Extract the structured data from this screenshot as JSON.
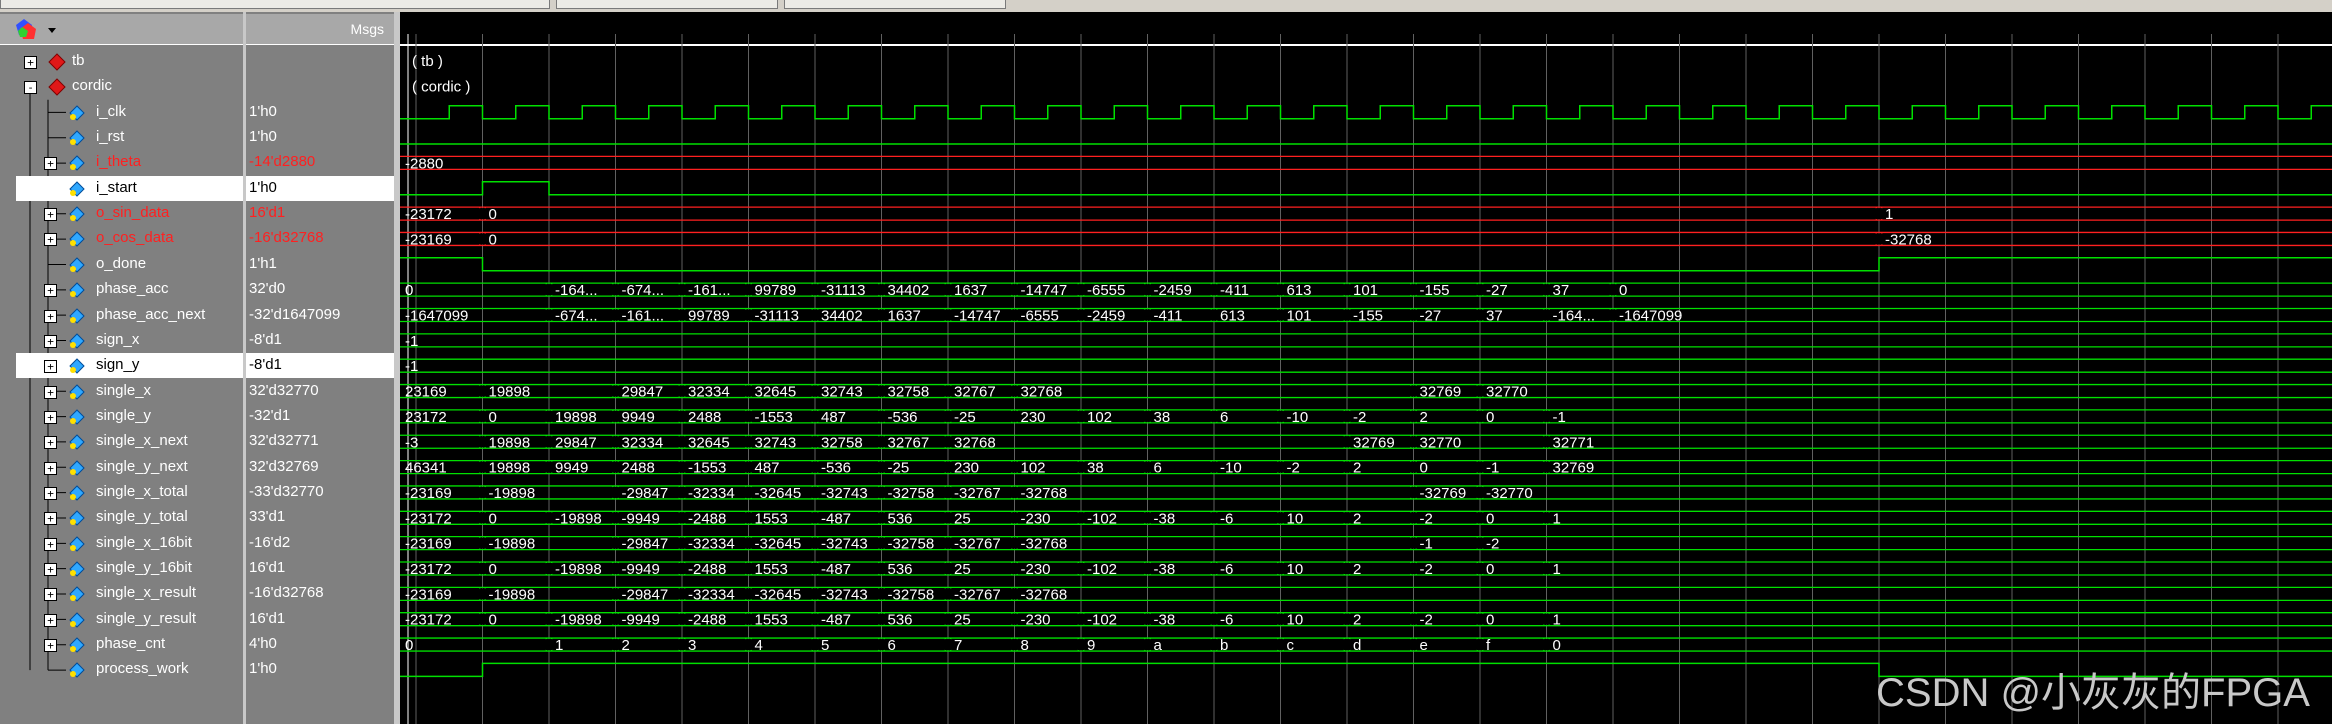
{
  "header": {
    "msgs_label": "Msgs"
  },
  "watermark": "CSDN @小灰灰的FPGA",
  "colors": {
    "wave": "#00e000",
    "red": "#ff2020",
    "cursor": "#ffffff",
    "grid": "#606060",
    "label": "#ffffff"
  },
  "signals": [
    {
      "name": "tb",
      "value": "",
      "kind": "instance",
      "expand": "+",
      "color": "white",
      "labels": [
        {
          "x": 0,
          "text": "( tb )"
        }
      ]
    },
    {
      "name": "cordic",
      "value": "",
      "kind": "instance",
      "expand": "-",
      "color": "white",
      "labels": [
        {
          "x": 0,
          "text": "( cordic )"
        }
      ]
    },
    {
      "name": "i_clk",
      "value": "1'h0",
      "kind": "clock",
      "color": "white"
    },
    {
      "name": "i_rst",
      "value": "1'h0",
      "kind": "low",
      "color": "white"
    },
    {
      "name": "i_theta",
      "value": "-14'd2880",
      "kind": "bus",
      "expand": "+",
      "color": "red",
      "labels": [
        {
          "x": 0,
          "text": "-2880"
        }
      ]
    },
    {
      "name": "i_start",
      "value": "1'h0",
      "kind": "pulse",
      "start": 1,
      "end": 2,
      "color": "white",
      "selected": true
    },
    {
      "name": "o_sin_data",
      "value": "16'd1",
      "kind": "bus",
      "expand": "+",
      "color": "red",
      "labels": [
        {
          "x": 0,
          "text": "-23172"
        },
        {
          "x": 1,
          "text": "0"
        },
        {
          "x": 22,
          "text": "1"
        }
      ]
    },
    {
      "name": "o_cos_data",
      "value": "-16'd32768",
      "kind": "bus",
      "expand": "+",
      "color": "red",
      "labels": [
        {
          "x": 0,
          "text": "-23169"
        },
        {
          "x": 1,
          "text": "0"
        },
        {
          "x": 22,
          "text": "-32768"
        }
      ]
    },
    {
      "name": "o_done",
      "value": "1'h1",
      "kind": "step_down_up",
      "down": 1,
      "up": 22,
      "color": "white"
    },
    {
      "name": "phase_acc",
      "value": "32'd0",
      "kind": "bus",
      "expand": "+",
      "color": "white",
      "labels": [
        {
          "x": 0,
          "text": "0"
        },
        {
          "x": 2,
          "text": "-164..."
        },
        {
          "x": 3,
          "text": "-674..."
        },
        {
          "x": 4,
          "text": "-161..."
        },
        {
          "x": 5,
          "text": "99789"
        },
        {
          "x": 6,
          "text": "-31113"
        },
        {
          "x": 7,
          "text": "34402"
        },
        {
          "x": 8,
          "text": "1637"
        },
        {
          "x": 9,
          "text": "-14747"
        },
        {
          "x": 10,
          "text": "-6555"
        },
        {
          "x": 11,
          "text": "-2459"
        },
        {
          "x": 12,
          "text": "-411"
        },
        {
          "x": 13,
          "text": "613"
        },
        {
          "x": 14,
          "text": "101"
        },
        {
          "x": 15,
          "text": "-155"
        },
        {
          "x": 16,
          "text": "-27"
        },
        {
          "x": 17,
          "text": "37"
        },
        {
          "x": 18,
          "text": "0"
        }
      ]
    },
    {
      "name": "phase_acc_next",
      "value": "-32'd1647099",
      "kind": "bus",
      "expand": "+",
      "color": "white",
      "labels": [
        {
          "x": 0,
          "text": "-1647099"
        },
        {
          "x": 2,
          "text": "-674..."
        },
        {
          "x": 3,
          "text": "-161..."
        },
        {
          "x": 4,
          "text": "99789"
        },
        {
          "x": 5,
          "text": "-31113"
        },
        {
          "x": 6,
          "text": "34402"
        },
        {
          "x": 7,
          "text": "1637"
        },
        {
          "x": 8,
          "text": "-14747"
        },
        {
          "x": 9,
          "text": "-6555"
        },
        {
          "x": 10,
          "text": "-2459"
        },
        {
          "x": 11,
          "text": "-411"
        },
        {
          "x": 12,
          "text": "613"
        },
        {
          "x": 13,
          "text": "101"
        },
        {
          "x": 14,
          "text": "-155"
        },
        {
          "x": 15,
          "text": "-27"
        },
        {
          "x": 16,
          "text": "37"
        },
        {
          "x": 17,
          "text": "-164..."
        },
        {
          "x": 18,
          "text": "-1647099"
        }
      ]
    },
    {
      "name": "sign_x",
      "value": "-8'd1",
      "kind": "bus",
      "expand": "+",
      "color": "white",
      "labels": [
        {
          "x": 0,
          "text": "-1"
        }
      ]
    },
    {
      "name": "sign_y",
      "value": "-8'd1",
      "kind": "bus",
      "expand": "+",
      "color": "white",
      "selected": true,
      "labels": [
        {
          "x": 0,
          "text": "-1"
        }
      ]
    },
    {
      "name": "single_x",
      "value": "32'd32770",
      "kind": "bus",
      "expand": "+",
      "color": "white",
      "labels": [
        {
          "x": 0,
          "text": "23169"
        },
        {
          "x": 1,
          "text": "19898"
        },
        {
          "x": 3,
          "text": "29847"
        },
        {
          "x": 4,
          "text": "32334"
        },
        {
          "x": 5,
          "text": "32645"
        },
        {
          "x": 6,
          "text": "32743"
        },
        {
          "x": 7,
          "text": "32758"
        },
        {
          "x": 8,
          "text": "32767"
        },
        {
          "x": 9,
          "text": "32768"
        },
        {
          "x": 15,
          "text": "32769"
        },
        {
          "x": 16,
          "text": "32770"
        }
      ]
    },
    {
      "name": "single_y",
      "value": "-32'd1",
      "kind": "bus",
      "expand": "+",
      "color": "white",
      "labels": [
        {
          "x": 0,
          "text": "23172"
        },
        {
          "x": 1,
          "text": "0"
        },
        {
          "x": 2,
          "text": "19898"
        },
        {
          "x": 3,
          "text": "9949"
        },
        {
          "x": 4,
          "text": "2488"
        },
        {
          "x": 5,
          "text": "-1553"
        },
        {
          "x": 6,
          "text": "487"
        },
        {
          "x": 7,
          "text": "-536"
        },
        {
          "x": 8,
          "text": "-25"
        },
        {
          "x": 9,
          "text": "230"
        },
        {
          "x": 10,
          "text": "102"
        },
        {
          "x": 11,
          "text": "38"
        },
        {
          "x": 12,
          "text": "6"
        },
        {
          "x": 13,
          "text": "-10"
        },
        {
          "x": 14,
          "text": "-2"
        },
        {
          "x": 15,
          "text": "2"
        },
        {
          "x": 16,
          "text": "0"
        },
        {
          "x": 17,
          "text": "-1"
        }
      ]
    },
    {
      "name": "single_x_next",
      "value": "32'd32771",
      "kind": "bus",
      "expand": "+",
      "color": "white",
      "labels": [
        {
          "x": 0,
          "text": "-3"
        },
        {
          "x": 1,
          "text": "19898"
        },
        {
          "x": 2,
          "text": "29847"
        },
        {
          "x": 3,
          "text": "32334"
        },
        {
          "x": 4,
          "text": "32645"
        },
        {
          "x": 5,
          "text": "32743"
        },
        {
          "x": 6,
          "text": "32758"
        },
        {
          "x": 7,
          "text": "32767"
        },
        {
          "x": 8,
          "text": "32768"
        },
        {
          "x": 14,
          "text": "32769"
        },
        {
          "x": 15,
          "text": "32770"
        },
        {
          "x": 17,
          "text": "32771"
        }
      ]
    },
    {
      "name": "single_y_next",
      "value": "32'd32769",
      "kind": "bus",
      "expand": "+",
      "color": "white",
      "labels": [
        {
          "x": 0,
          "text": "46341"
        },
        {
          "x": 1,
          "text": "19898"
        },
        {
          "x": 2,
          "text": "9949"
        },
        {
          "x": 3,
          "text": "2488"
        },
        {
          "x": 4,
          "text": "-1553"
        },
        {
          "x": 5,
          "text": "487"
        },
        {
          "x": 6,
          "text": "-536"
        },
        {
          "x": 7,
          "text": "-25"
        },
        {
          "x": 8,
          "text": "230"
        },
        {
          "x": 9,
          "text": "102"
        },
        {
          "x": 10,
          "text": "38"
        },
        {
          "x": 11,
          "text": "6"
        },
        {
          "x": 12,
          "text": "-10"
        },
        {
          "x": 13,
          "text": "-2"
        },
        {
          "x": 14,
          "text": "2"
        },
        {
          "x": 15,
          "text": "0"
        },
        {
          "x": 16,
          "text": "-1"
        },
        {
          "x": 17,
          "text": "32769"
        }
      ]
    },
    {
      "name": "single_x_total",
      "value": "-33'd32770",
      "kind": "bus",
      "expand": "+",
      "color": "white",
      "labels": [
        {
          "x": 0,
          "text": "-23169"
        },
        {
          "x": 1,
          "text": "-19898"
        },
        {
          "x": 3,
          "text": "-29847"
        },
        {
          "x": 4,
          "text": "-32334"
        },
        {
          "x": 5,
          "text": "-32645"
        },
        {
          "x": 6,
          "text": "-32743"
        },
        {
          "x": 7,
          "text": "-32758"
        },
        {
          "x": 8,
          "text": "-32767"
        },
        {
          "x": 9,
          "text": "-32768"
        },
        {
          "x": 15,
          "text": "-32769"
        },
        {
          "x": 16,
          "text": "-32770"
        }
      ]
    },
    {
      "name": "single_y_total",
      "value": "33'd1",
      "kind": "bus",
      "expand": "+",
      "color": "white",
      "labels": [
        {
          "x": 0,
          "text": "-23172"
        },
        {
          "x": 1,
          "text": "0"
        },
        {
          "x": 2,
          "text": "-19898"
        },
        {
          "x": 3,
          "text": "-9949"
        },
        {
          "x": 4,
          "text": "-2488"
        },
        {
          "x": 5,
          "text": "1553"
        },
        {
          "x": 6,
          "text": "-487"
        },
        {
          "x": 7,
          "text": "536"
        },
        {
          "x": 8,
          "text": "25"
        },
        {
          "x": 9,
          "text": "-230"
        },
        {
          "x": 10,
          "text": "-102"
        },
        {
          "x": 11,
          "text": "-38"
        },
        {
          "x": 12,
          "text": "-6"
        },
        {
          "x": 13,
          "text": "10"
        },
        {
          "x": 14,
          "text": "2"
        },
        {
          "x": 15,
          "text": "-2"
        },
        {
          "x": 16,
          "text": "0"
        },
        {
          "x": 17,
          "text": "1"
        }
      ]
    },
    {
      "name": "single_x_16bit",
      "value": "-16'd2",
      "kind": "bus",
      "expand": "+",
      "color": "white",
      "labels": [
        {
          "x": 0,
          "text": "-23169"
        },
        {
          "x": 1,
          "text": "-19898"
        },
        {
          "x": 3,
          "text": "-29847"
        },
        {
          "x": 4,
          "text": "-32334"
        },
        {
          "x": 5,
          "text": "-32645"
        },
        {
          "x": 6,
          "text": "-32743"
        },
        {
          "x": 7,
          "text": "-32758"
        },
        {
          "x": 8,
          "text": "-32767"
        },
        {
          "x": 9,
          "text": "-32768"
        },
        {
          "x": 15,
          "text": "-1"
        },
        {
          "x": 16,
          "text": "-2"
        }
      ]
    },
    {
      "name": "single_y_16bit",
      "value": "16'd1",
      "kind": "bus",
      "expand": "+",
      "color": "white",
      "labels": [
        {
          "x": 0,
          "text": "-23172"
        },
        {
          "x": 1,
          "text": "0"
        },
        {
          "x": 2,
          "text": "-19898"
        },
        {
          "x": 3,
          "text": "-9949"
        },
        {
          "x": 4,
          "text": "-2488"
        },
        {
          "x": 5,
          "text": "1553"
        },
        {
          "x": 6,
          "text": "-487"
        },
        {
          "x": 7,
          "text": "536"
        },
        {
          "x": 8,
          "text": "25"
        },
        {
          "x": 9,
          "text": "-230"
        },
        {
          "x": 10,
          "text": "-102"
        },
        {
          "x": 11,
          "text": "-38"
        },
        {
          "x": 12,
          "text": "-6"
        },
        {
          "x": 13,
          "text": "10"
        },
        {
          "x": 14,
          "text": "2"
        },
        {
          "x": 15,
          "text": "-2"
        },
        {
          "x": 16,
          "text": "0"
        },
        {
          "x": 17,
          "text": "1"
        }
      ]
    },
    {
      "name": "single_x_result",
      "value": "-16'd32768",
      "kind": "bus",
      "expand": "+",
      "color": "white",
      "labels": [
        {
          "x": 0,
          "text": "-23169"
        },
        {
          "x": 1,
          "text": "-19898"
        },
        {
          "x": 3,
          "text": "-29847"
        },
        {
          "x": 4,
          "text": "-32334"
        },
        {
          "x": 5,
          "text": "-32645"
        },
        {
          "x": 6,
          "text": "-32743"
        },
        {
          "x": 7,
          "text": "-32758"
        },
        {
          "x": 8,
          "text": "-32767"
        },
        {
          "x": 9,
          "text": "-32768"
        }
      ]
    },
    {
      "name": "single_y_result",
      "value": "16'd1",
      "kind": "bus",
      "expand": "+",
      "color": "white",
      "labels": [
        {
          "x": 0,
          "text": "-23172"
        },
        {
          "x": 1,
          "text": "0"
        },
        {
          "x": 2,
          "text": "-19898"
        },
        {
          "x": 3,
          "text": "-9949"
        },
        {
          "x": 4,
          "text": "-2488"
        },
        {
          "x": 5,
          "text": "1553"
        },
        {
          "x": 6,
          "text": "-487"
        },
        {
          "x": 7,
          "text": "536"
        },
        {
          "x": 8,
          "text": "25"
        },
        {
          "x": 9,
          "text": "-230"
        },
        {
          "x": 10,
          "text": "-102"
        },
        {
          "x": 11,
          "text": "-38"
        },
        {
          "x": 12,
          "text": "-6"
        },
        {
          "x": 13,
          "text": "10"
        },
        {
          "x": 14,
          "text": "2"
        },
        {
          "x": 15,
          "text": "-2"
        },
        {
          "x": 16,
          "text": "0"
        },
        {
          "x": 17,
          "text": "1"
        }
      ]
    },
    {
      "name": "phase_cnt",
      "value": "4'h0",
      "kind": "bus",
      "expand": "+",
      "color": "white",
      "labels": [
        {
          "x": 0,
          "text": "0"
        },
        {
          "x": 2,
          "text": "1"
        },
        {
          "x": 3,
          "text": "2"
        },
        {
          "x": 4,
          "text": "3"
        },
        {
          "x": 5,
          "text": "4"
        },
        {
          "x": 6,
          "text": "5"
        },
        {
          "x": 7,
          "text": "6"
        },
        {
          "x": 8,
          "text": "7"
        },
        {
          "x": 9,
          "text": "8"
        },
        {
          "x": 10,
          "text": "9"
        },
        {
          "x": 11,
          "text": "a"
        },
        {
          "x": 12,
          "text": "b"
        },
        {
          "x": 13,
          "text": "c"
        },
        {
          "x": 14,
          "text": "d"
        },
        {
          "x": 15,
          "text": "e"
        },
        {
          "x": 16,
          "text": "f"
        },
        {
          "x": 17,
          "text": "0"
        }
      ]
    },
    {
      "name": "process_work",
      "value": "1'h0",
      "kind": "step_up_down",
      "up": 1,
      "down": 22,
      "color": "white"
    }
  ]
}
